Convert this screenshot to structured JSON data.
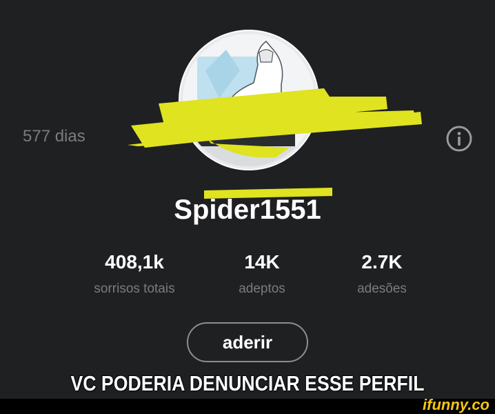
{
  "profile": {
    "days": "577 dias",
    "username": "Spider1551",
    "join_label": "aderir"
  },
  "stats": [
    {
      "value": "408,1k",
      "label": "sorrisos totais"
    },
    {
      "value": "14K",
      "label": "adeptos"
    },
    {
      "value": "2.7K",
      "label": "adesões"
    }
  ],
  "meme": {
    "caption": "VC PODERIA DENUNCIAR ESSE PERFIL",
    "watermark": "ifunny.co"
  },
  "icons": {
    "info": "info-icon"
  },
  "colors": {
    "background": "#1f2022",
    "muted_text": "#7b7c80",
    "scribble": "#dfe320",
    "watermark": "#f5c518"
  }
}
